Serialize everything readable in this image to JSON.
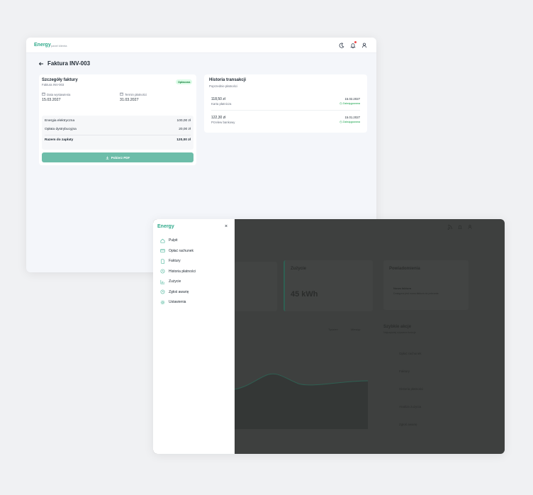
{
  "app": {
    "brand": "Energy",
    "brand_sub": "panel klienta"
  },
  "invoice_page": {
    "title": "Faktura INV-003",
    "details": {
      "heading": "Szczegóły faktury",
      "subheading": "Faktura INV-003",
      "status": "Opłacona",
      "issue_label": "Data wystawienia",
      "issue_date": "15.03.2027",
      "due_label": "Termin płatności",
      "due_date": "31.03.2027",
      "lines": [
        {
          "label": "Energia elektryczna",
          "amount": "100,00 zł"
        },
        {
          "label": "Opłata dystrybucyjna",
          "amount": "20,00 zł"
        }
      ],
      "total_label": "Razem do zapłaty",
      "total_amount": "120,00 zł",
      "download_label": "Pobierz PDF"
    },
    "history": {
      "heading": "Historia transakcji",
      "subheading": "Poprzednie płatności",
      "transactions": [
        {
          "amount": "118,50 zł",
          "method": "Karta płatnicza",
          "date": "15.02.2027",
          "status": "Zaksięgowana"
        },
        {
          "amount": "122,30 zł",
          "method": "Przelew bankowy",
          "date": "15.01.2027",
          "status": "Zaksięgowana"
        }
      ]
    }
  },
  "dashboard": {
    "brand": "Energy",
    "nav": [
      {
        "label": "Pulpit",
        "icon": "home-icon"
      },
      {
        "label": "Opłać rachunek",
        "icon": "card-icon"
      },
      {
        "label": "Faktury",
        "icon": "document-icon"
      },
      {
        "label": "Historia płatności",
        "icon": "history-icon"
      },
      {
        "label": "Zużycie",
        "icon": "chart-icon"
      },
      {
        "label": "Zgłoś awarię",
        "icon": "clock-icon"
      },
      {
        "label": "Ustawienia",
        "icon": "gear-icon"
      }
    ],
    "usage": {
      "title": "Zużycie",
      "value": "45 kWh"
    },
    "notifications": {
      "title": "Powiadomienia",
      "item_title": "Nowa faktura",
      "item_text": "Dostępna jest nowa faktura do pobrania"
    },
    "quick": {
      "title": "Szybkie akcje",
      "subtitle": "Najczęściej używane funkcje",
      "items": [
        "Opłać rachunek",
        "Faktury",
        "Historia płatności",
        "Analiza zużycia",
        "Zgłoś awarię"
      ]
    },
    "chart_tabs": [
      "Tydzień",
      "Miesiąc"
    ]
  },
  "colors": {
    "brand": "#2ea98a",
    "success": "#16a34a",
    "button": "#6dbda9",
    "overlay": "#3e403f"
  }
}
